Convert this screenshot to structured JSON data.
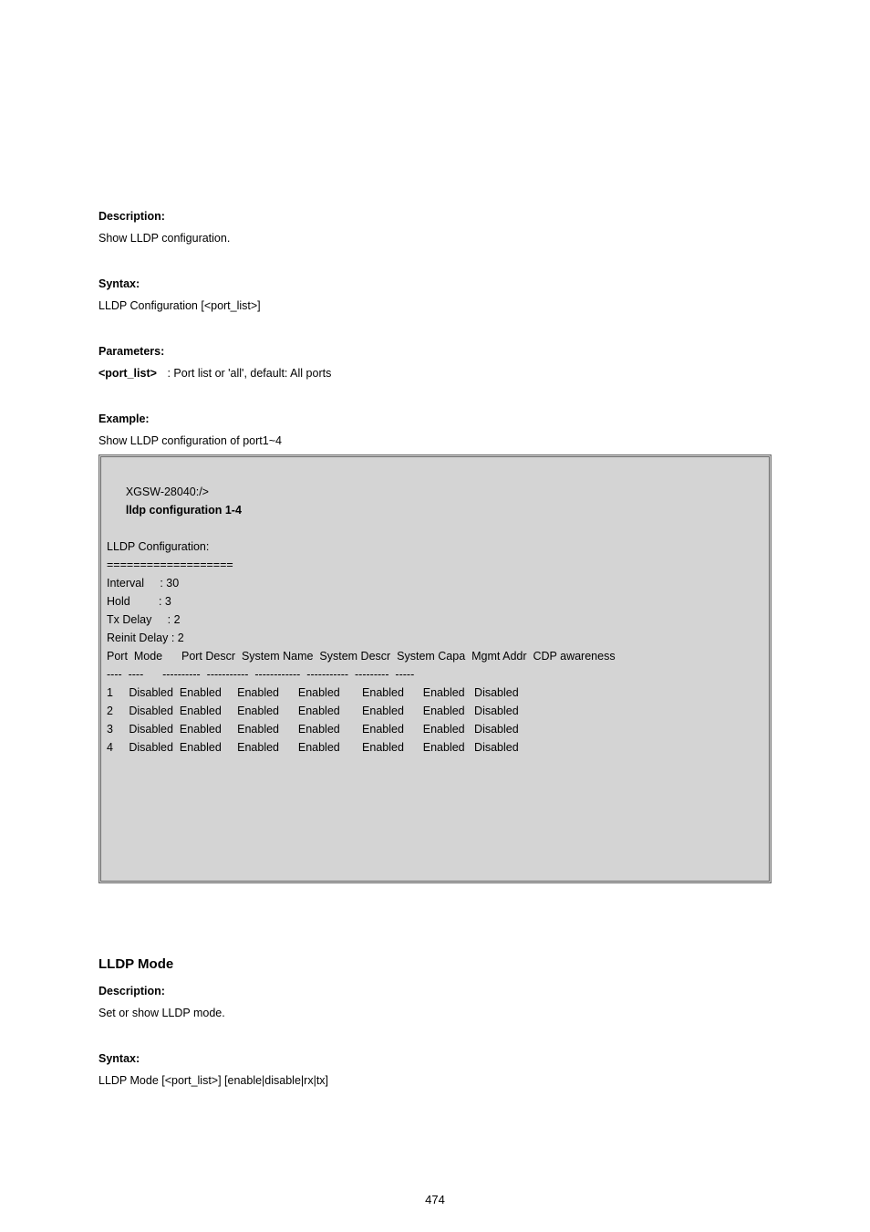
{
  "section1": {
    "desc_label": "Description:",
    "desc_text": "Show LLDP configuration.",
    "syntax_label": "Syntax:",
    "syntax_text": "LLDP Configuration [<port_list>]",
    "params_label": "Parameters:",
    "param_name": "<port_list>",
    "param_desc": ": Port list or 'all', default: All ports",
    "example_label": "Example:",
    "example_text": "Show LLDP configuration of port1~4"
  },
  "terminal": {
    "prompt": "XGSW-28040:/>",
    "cmd": "lldp configuration 1-4",
    "lines": [
      "LLDP Configuration:",
      "===================",
      "",
      "Interval     : 30",
      "Hold         : 3",
      "Tx Delay     : 2",
      "Reinit Delay : 2",
      "",
      "Port  Mode      Port Descr  System Name  System Descr  System Capa  Mgmt Addr  CDP awareness",
      "----  ----      ----------  -----------  ------------  -----------  ---------  -----",
      "1     Disabled  Enabled     Enabled      Enabled       Enabled      Enabled   Disabled ",
      "2     Disabled  Enabled     Enabled      Enabled       Enabled      Enabled   Disabled ",
      "3     Disabled  Enabled     Enabled      Enabled       Enabled      Enabled   Disabled ",
      "4     Disabled  Enabled     Enabled      Enabled       Enabled      Enabled   Disabled "
    ]
  },
  "section2": {
    "heading": "LLDP Mode",
    "desc_label": "Description:",
    "desc_text": "Set or show LLDP mode.",
    "syntax_label": "Syntax:",
    "syntax_text": "LLDP Mode [<port_list>] [enable|disable|rx|tx]"
  },
  "page_number": "474"
}
